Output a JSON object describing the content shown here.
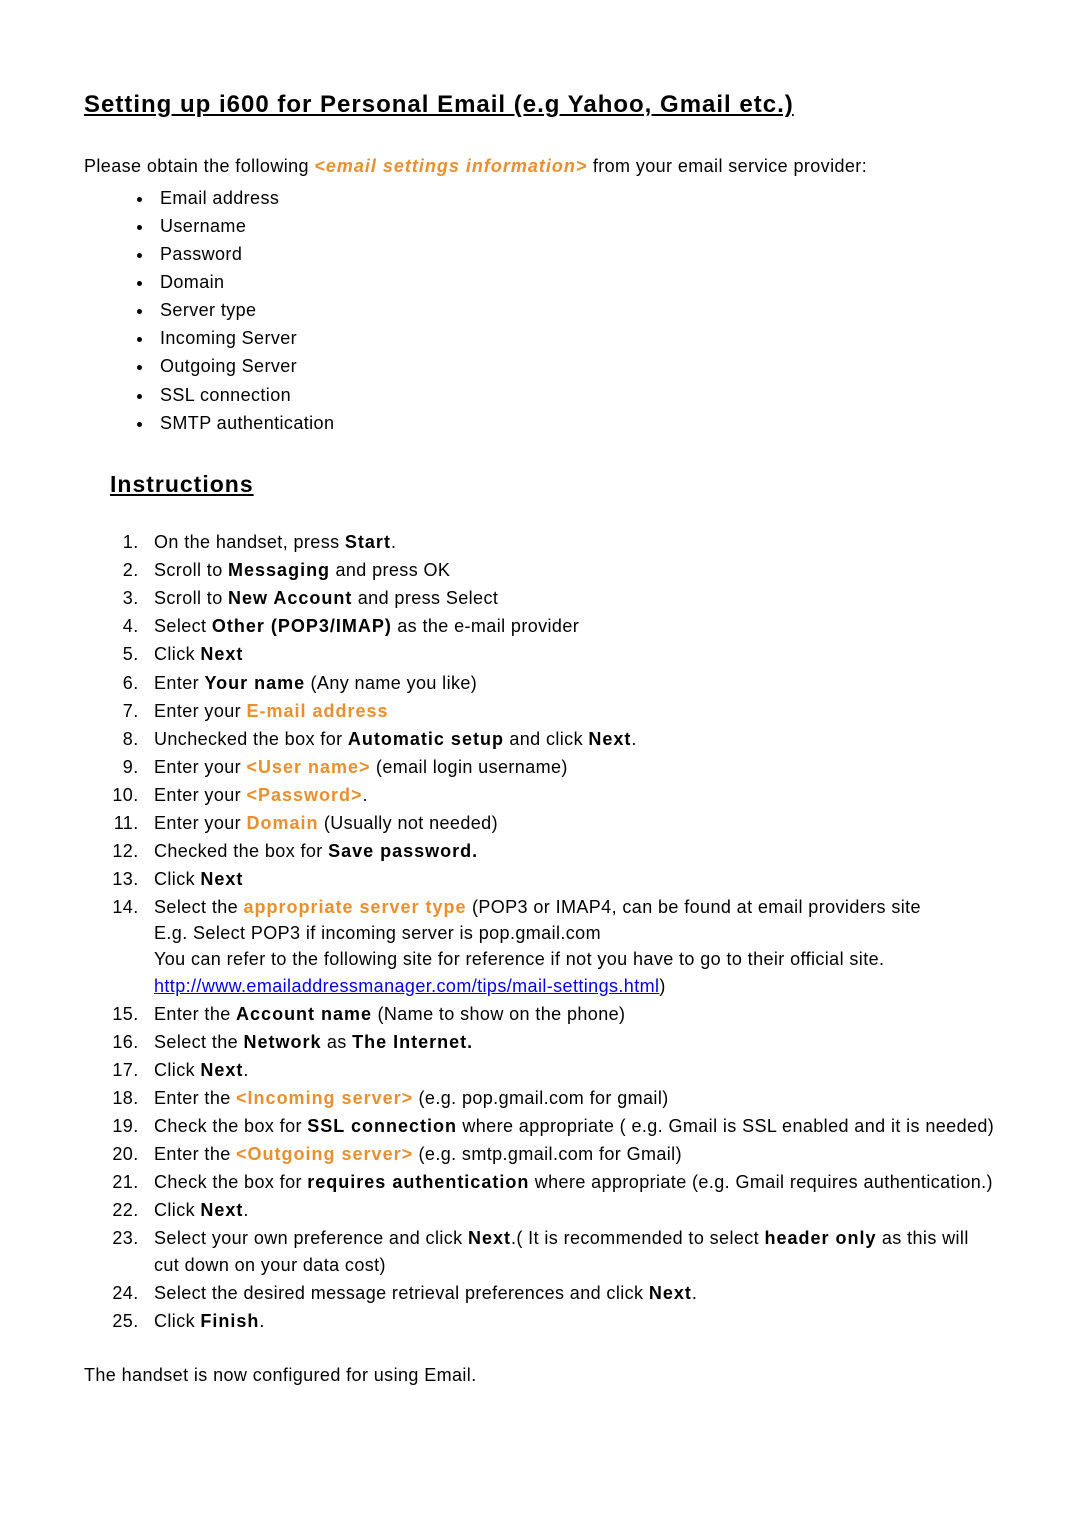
{
  "title": "Setting up i600 for Personal Email (e.g Yahoo, Gmail etc.)",
  "intro": {
    "before": "Please obtain the following ",
    "em": "<email settings information>",
    "after": " from your email service provider:"
  },
  "info_items": [
    "Email address",
    "Username",
    "Password",
    "Domain",
    "Server type",
    "Incoming Server",
    "Outgoing Server",
    "SSL connection",
    "SMTP authentication"
  ],
  "instructions_heading": "Instructions",
  "steps": {
    "s1": {
      "a": "On the handset, press ",
      "b": "Start",
      "c": "."
    },
    "s2": {
      "a": "Scroll to ",
      "b": "Messaging",
      "c": " and press OK"
    },
    "s3": {
      "a": "Scroll to ",
      "b": "New Account",
      "c": " and press Select"
    },
    "s4": {
      "a": " Select ",
      "b": "Other (POP3/IMAP)",
      "c": " as the e-mail provider"
    },
    "s5": {
      "a": "Click ",
      "b": "Next"
    },
    "s6": {
      "a": "Enter ",
      "b": "Your name",
      "c": " (Any name you like)"
    },
    "s7": {
      "a": "Enter your ",
      "b": "E-mail address"
    },
    "s8": {
      "a": "Unchecked the box for ",
      "b": "Automatic setup",
      "c": " and click ",
      "d": "Next",
      "e": "."
    },
    "s9": {
      "a": "Enter your ",
      "b": "<User name>",
      "c": " (email login username)"
    },
    "s10": {
      "a": "Enter your ",
      "b": "<Password>",
      "c": "."
    },
    "s11": {
      "a": "Enter your ",
      "b": "Domain",
      "c": " (Usually not needed)"
    },
    "s12": {
      "a": "Checked the box for ",
      "b": "Save password."
    },
    "s13": {
      "a": "Click ",
      "b": "Next"
    },
    "s14": {
      "a": "Select the ",
      "b": "appropriate server type",
      "c": " (POP3 or IMAP4, can be found at email providers site",
      "d": "E.g. Select POP3 if incoming server is pop.gmail.com",
      "e": "You can refer to the following site for reference if not you have to go to their official site. ",
      "link": "http://www.emailaddressmanager.com/tips/mail-settings.html",
      "f": ")"
    },
    "s15": {
      "a": "Enter the ",
      "b": "Account name",
      "c": " (Name to show on the phone)"
    },
    "s16": {
      "a": "Select the ",
      "b": "Network",
      "c": " as ",
      "d": "The Internet."
    },
    "s17": {
      "a": "Click ",
      "b": "Next",
      "c": "."
    },
    "s18": {
      "a": "Enter the ",
      "b": "<Incoming server>",
      "c": " (e.g. pop.gmail.com for gmail)"
    },
    "s19": {
      "a": "Check the box for ",
      "b": "SSL connection",
      "c": " where appropriate ( e.g. Gmail is SSL enabled and it is needed)"
    },
    "s20": {
      "a": "Enter the ",
      "b": "<Outgoing server>",
      "c": " (e.g. smtp.gmail.com for Gmail)"
    },
    "s21": {
      "a": "Check the box for ",
      "b": "requires authentication",
      "c": " where appropriate (e.g. Gmail requires authentication.)"
    },
    "s22": {
      "a": "Click ",
      "b": "Next",
      "c": "."
    },
    "s23": {
      "a": "Select your own preference and click ",
      "b": "Next",
      "c": ".( It is recommended to select ",
      "d": "header only",
      "e": " as this will cut down on your data cost)"
    },
    "s24": {
      "a": "Select the desired message retrieval preferences and click ",
      "b": "Next",
      "c": "."
    },
    "s25": {
      "a": "Click ",
      "b": "Finish",
      "c": "."
    }
  },
  "outro": "The handset is now configured for using Email."
}
